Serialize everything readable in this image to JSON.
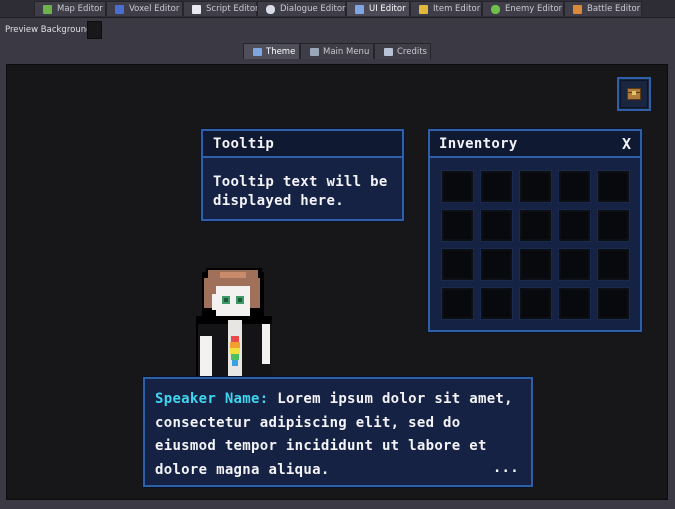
{
  "editor_tabs": [
    {
      "label": "Map Editor",
      "icon": "map-icon",
      "color": "#6bb34a"
    },
    {
      "label": "Voxel Editor",
      "icon": "voxel-icon",
      "color": "#4a6fd0"
    },
    {
      "label": "Script Editor",
      "icon": "script-icon",
      "color": "#e8e8f0"
    },
    {
      "label": "Dialogue Editor",
      "icon": "speech-bubble-icon",
      "color": "#d8dbe8"
    },
    {
      "label": "UI Editor",
      "icon": "ui-window-icon",
      "color": "#7fa6e0"
    },
    {
      "label": "Item Editor",
      "icon": "key-icon",
      "color": "#e0b83c"
    },
    {
      "label": "Enemy Editor",
      "icon": "enemy-icon",
      "color": "#6fc04a"
    },
    {
      "label": "Battle Editor",
      "icon": "battle-icon",
      "color": "#d8893a"
    }
  ],
  "preview_background": {
    "label": "Preview Background:",
    "color": "#18181b"
  },
  "sub_tabs": [
    {
      "label": "Theme",
      "icon": "theme-icon",
      "color": "#7fa6e0"
    },
    {
      "label": "Main Menu",
      "icon": "main-menu-icon",
      "color": "#9aa7b8"
    },
    {
      "label": "Credits",
      "icon": "credits-icon",
      "color": "#b8c3d6"
    }
  ],
  "tooltip": {
    "title": "Tooltip",
    "body": "Tooltip text will be displayed here."
  },
  "inventory": {
    "title": "Inventory",
    "close_label": "X"
  },
  "inventory_toggle": {
    "icon": "chest-icon"
  },
  "dialogue": {
    "speaker": "Speaker Name:",
    "text": " Lorem ipsum dolor sit amet, consectetur adipiscing elit, sed do eiusmod tempor incididunt ut labore et dolore magna aliqua.",
    "more": "..."
  },
  "theme": {
    "accent": "#2f5fa6",
    "panel_bg": "#152244",
    "speaker_color": "#3fd6f0"
  }
}
